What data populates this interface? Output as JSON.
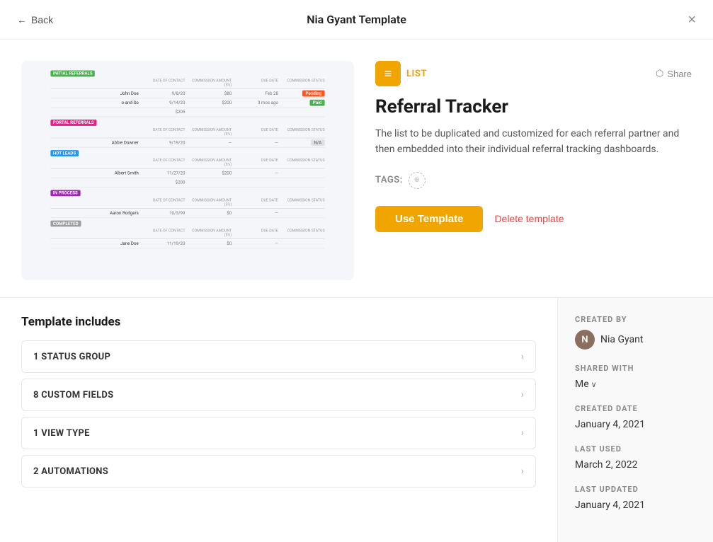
{
  "header": {
    "title": "Nia Gyant Template",
    "back_label": "Back",
    "close_icon": "×"
  },
  "type_badge": {
    "icon": "≡",
    "label": "LIST"
  },
  "share_label": "Share",
  "template": {
    "title": "Referral Tracker",
    "description": "The list to be duplicated and customized for each referral partner and then embedded into their individual referral tracking dashboards.",
    "tags_label": "TAGS:",
    "use_button": "Use Template",
    "delete_button": "Delete template"
  },
  "includes": {
    "title": "Template includes",
    "items": [
      {
        "count": "1",
        "label": "STATUS GROUP"
      },
      {
        "count": "8",
        "label": "CUSTOM FIELDS"
      },
      {
        "count": "1",
        "label": "VIEW TYPE"
      },
      {
        "count": "2",
        "label": "AUTOMATIONS"
      }
    ]
  },
  "sidebar": {
    "created_by_label": "CREATED BY",
    "creator_name": "Nia Gyant",
    "creator_avatar_initials": "N",
    "shared_with_label": "SHARED WITH",
    "shared_with_value": "Me",
    "created_date_label": "CREATED DATE",
    "created_date": "January 4, 2021",
    "last_used_label": "LAST USED",
    "last_used": "March 2, 2022",
    "last_updated_label": "LAST UPDATED",
    "last_updated": "January 4, 2021"
  },
  "preview": {
    "sections": [
      {
        "tag": "INITIAL REFERRALS",
        "tag_color": "green",
        "rows": [
          {
            "name": "John Doe",
            "date": "9/8/20",
            "amount": "$80",
            "due": "Feb 28",
            "status": "Pending",
            "status_color": "pending"
          },
          {
            "name": "o-and-So",
            "date": "9/14/20",
            "amount": "$200",
            "due": "3 mos ago",
            "status": "Paid",
            "status_color": "paid"
          }
        ]
      },
      {
        "tag": "PORTAL REFERRALS",
        "tag_color": "pink",
        "rows": [
          {
            "name": "Abbie Downer",
            "date": "9/19/20",
            "amount": "—",
            "due": "—",
            "status": "N/A",
            "status_color": "na"
          }
        ]
      },
      {
        "tag": "HOT LEADS",
        "tag_color": "blue",
        "rows": [
          {
            "name": "Albert Smith",
            "date": "11/27/20",
            "amount": "$200",
            "due": "—",
            "status": "",
            "status_color": ""
          }
        ]
      },
      {
        "tag": "IN PROCESS",
        "tag_color": "purple",
        "rows": [
          {
            "name": "Aaron Rodgers",
            "date": "10/3/99",
            "amount": "$0",
            "due": "—",
            "status": "",
            "status_color": ""
          }
        ]
      },
      {
        "tag": "COMPLETED",
        "tag_color": "gray",
        "rows": [
          {
            "name": "Jane Doe",
            "date": "11/19/20",
            "amount": "$0",
            "due": "—",
            "status": "",
            "status_color": ""
          }
        ]
      }
    ]
  }
}
